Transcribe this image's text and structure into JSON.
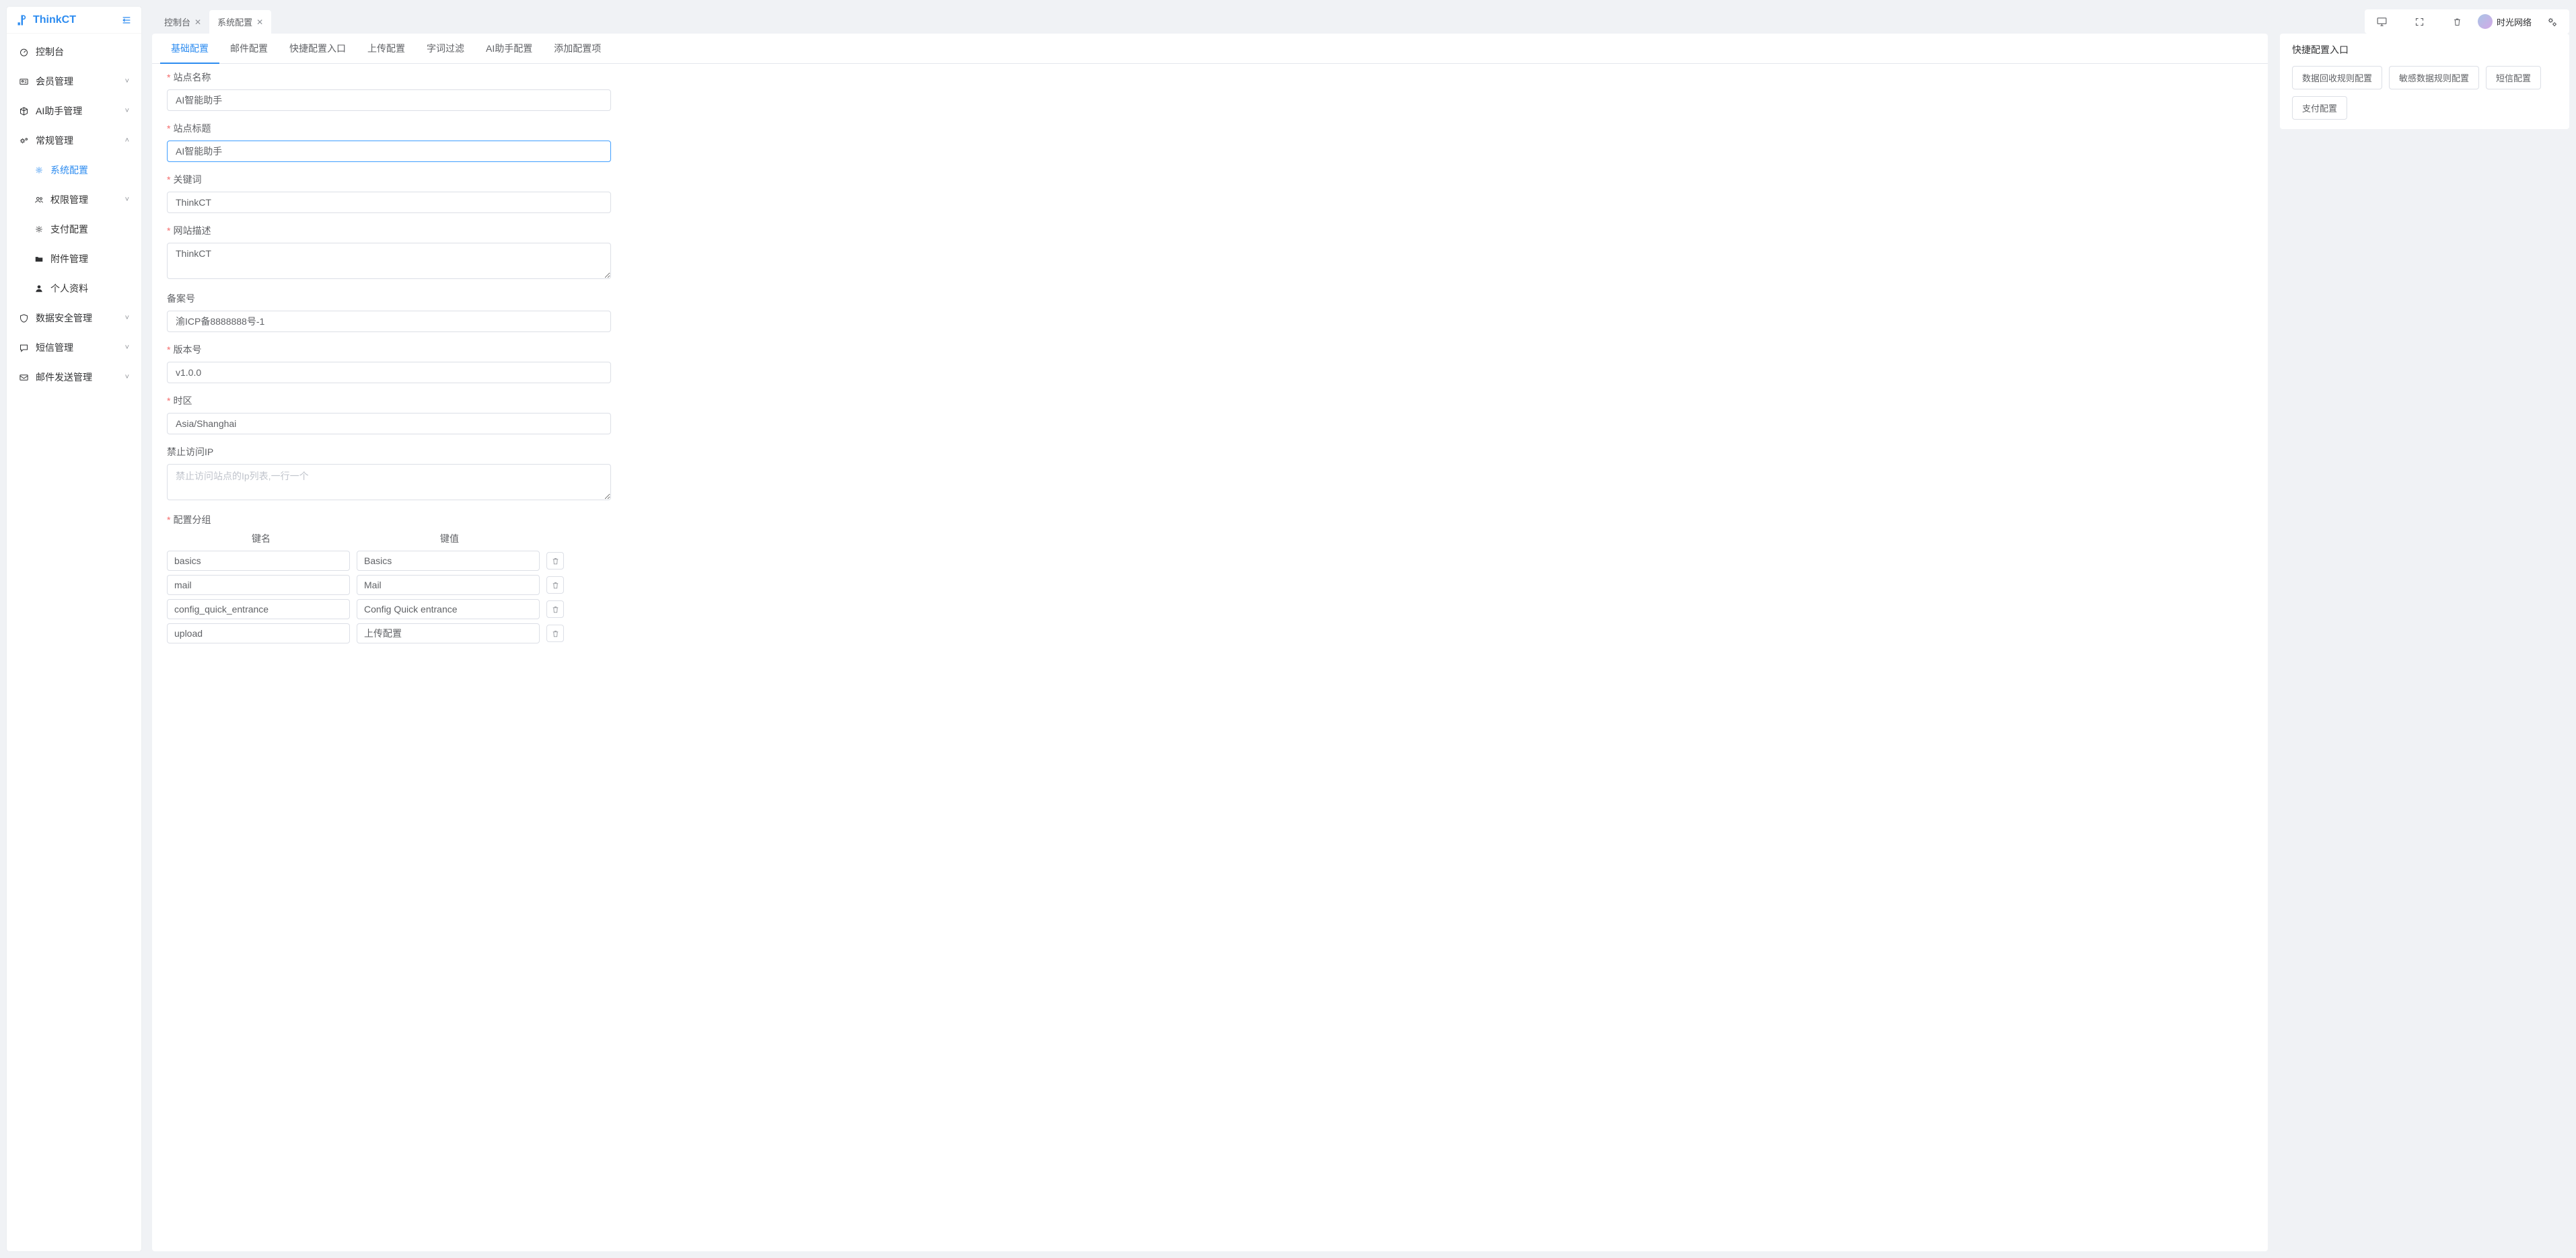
{
  "brand": "ThinkCT",
  "header": {
    "username": "时光网络"
  },
  "tabs": [
    {
      "label": "控制台",
      "active": false
    },
    {
      "label": "系统配置",
      "active": true
    }
  ],
  "sidebar": {
    "items": [
      {
        "icon": "dashboard",
        "label": "控制台",
        "type": "item"
      },
      {
        "icon": "id-card",
        "label": "会员管理",
        "type": "submenu",
        "open": false
      },
      {
        "icon": "cube",
        "label": "AI助手管理",
        "type": "submenu",
        "open": false
      },
      {
        "icon": "gears",
        "label": "常规管理",
        "type": "submenu",
        "open": true,
        "children": [
          {
            "icon": "gear",
            "label": "系统配置",
            "active": true
          },
          {
            "icon": "users",
            "label": "权限管理",
            "hasArrow": true
          },
          {
            "icon": "gear",
            "label": "支付配置"
          },
          {
            "icon": "folder",
            "label": "附件管理"
          },
          {
            "icon": "user",
            "label": "个人资料"
          }
        ]
      },
      {
        "icon": "shield",
        "label": "数据安全管理",
        "type": "submenu",
        "open": false
      },
      {
        "icon": "chat",
        "label": "短信管理",
        "type": "submenu",
        "open": false
      },
      {
        "icon": "mail",
        "label": "邮件发送管理",
        "type": "submenu",
        "open": false
      }
    ]
  },
  "innerTabs": [
    "基础配置",
    "邮件配置",
    "快捷配置入口",
    "上传配置",
    "字词过滤",
    "AI助手配置",
    "添加配置项"
  ],
  "form": {
    "site_name": {
      "label": "站点名称",
      "required": true,
      "value": "AI智能助手"
    },
    "site_title": {
      "label": "站点标题",
      "required": true,
      "value": "AI智能助手",
      "focused": true
    },
    "keywords": {
      "label": "关键词",
      "required": true,
      "value": "ThinkCT"
    },
    "description": {
      "label": "网站描述",
      "required": true,
      "value": "ThinkCT"
    },
    "icp": {
      "label": "备案号",
      "required": false,
      "value": "渝ICP备8888888号-1"
    },
    "version": {
      "label": "版本号",
      "required": true,
      "value": "v1.0.0"
    },
    "timezone": {
      "label": "时区",
      "required": true,
      "value": "Asia/Shanghai"
    },
    "forbid_ip": {
      "label": "禁止访问IP",
      "required": false,
      "value": "",
      "placeholder": "禁止访问站点的Ip列表,一行一个"
    },
    "config_group": {
      "label": "配置分组",
      "required": true
    }
  },
  "kv": {
    "head_key": "键名",
    "head_val": "键值",
    "rows": [
      {
        "k": "basics",
        "v": "Basics"
      },
      {
        "k": "mail",
        "v": "Mail"
      },
      {
        "k": "config_quick_entrance",
        "v": "Config Quick entrance"
      },
      {
        "k": "upload",
        "v": "上传配置"
      }
    ]
  },
  "quick": {
    "title": "快捷配置入口",
    "buttons": [
      "数据回收规则配置",
      "敏感数据规则配置",
      "短信配置",
      "支付配置"
    ]
  }
}
